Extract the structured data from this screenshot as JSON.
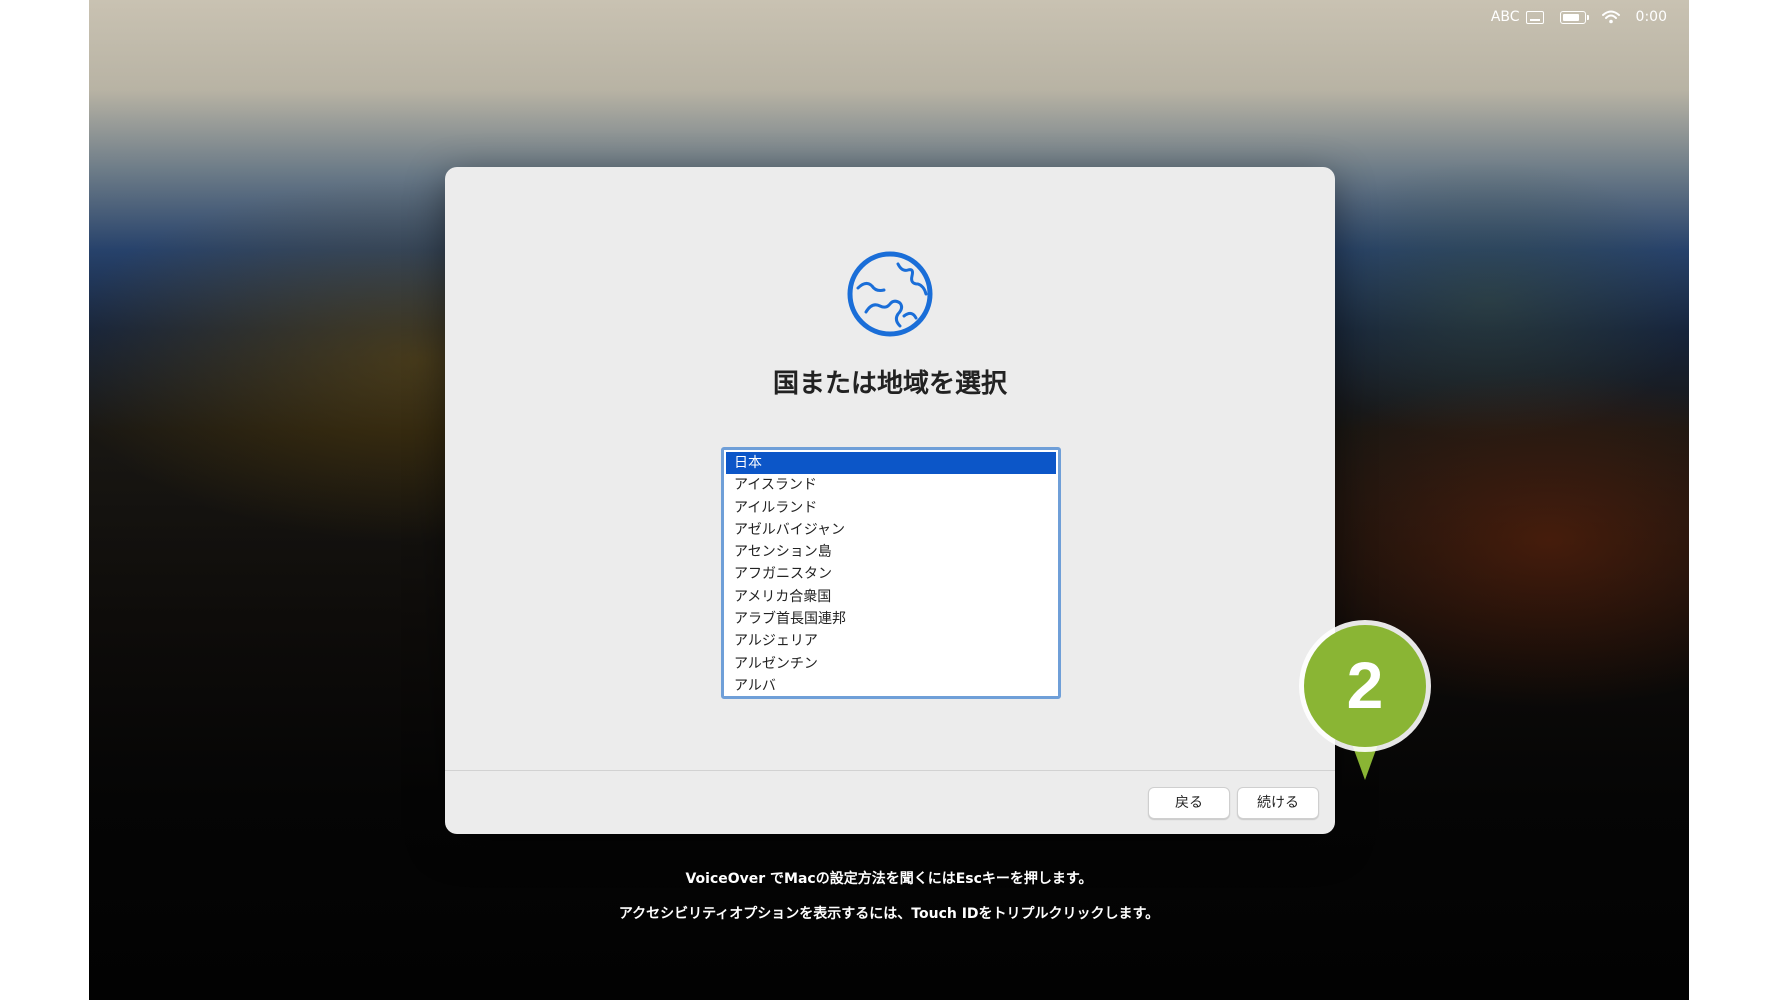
{
  "menubar": {
    "input_source": "ABC",
    "clock": "0:00",
    "icons": [
      "keyboard-icon",
      "battery-icon",
      "wifi-icon"
    ]
  },
  "dialog": {
    "icon": "globe-icon",
    "title": "国または地域を選択",
    "list": {
      "selected": "日本",
      "items": [
        "日本",
        "アイスランド",
        "アイルランド",
        "アゼルバイジャン",
        "アセンション島",
        "アフガニスタン",
        "アメリカ合衆国",
        "アラブ首長国連邦",
        "アルジェリア",
        "アルゼンチン",
        "アルバ"
      ]
    },
    "buttons": {
      "back": "戻る",
      "continue": "続ける"
    }
  },
  "annotation": {
    "step": "2",
    "color": "#8ab534"
  },
  "footer": {
    "voiceover": "VoiceOver でMacの設定方法を聞くにはEscキーを押します。",
    "accessibility": "アクセシビリティオプションを表示するには、Touch IDをトリプルクリックします。"
  },
  "colors": {
    "accent": "#0c56c8",
    "globe": "#1a6ed8"
  }
}
